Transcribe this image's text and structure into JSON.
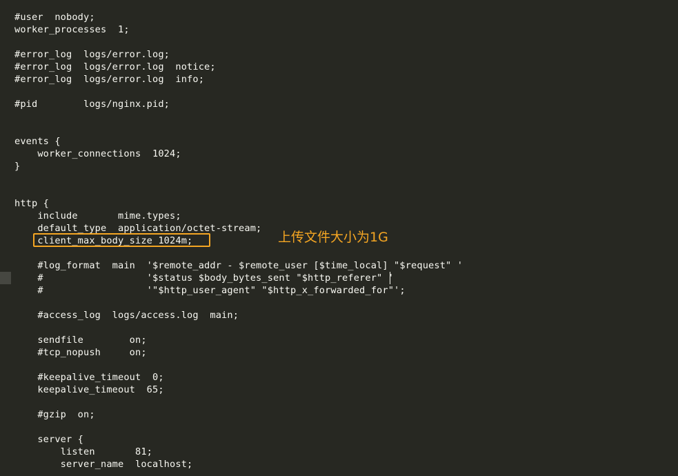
{
  "editor": {
    "lines": [
      "#user  nobody;",
      "worker_processes  1;",
      "",
      "#error_log  logs/error.log;",
      "#error_log  logs/error.log  notice;",
      "#error_log  logs/error.log  info;",
      "",
      "#pid        logs/nginx.pid;",
      "",
      "",
      "events {",
      "    worker_connections  1024;",
      "}",
      "",
      "",
      "http {",
      "    include       mime.types;",
      "    default_type  application/octet-stream;",
      "    client_max_body_size 1024m;",
      "",
      "    #log_format  main  '$remote_addr - $remote_user [$time_local] \"$request\" '",
      "    #                  '$status $body_bytes_sent \"$http_referer\" '",
      "    #                  '\"$http_user_agent\" \"$http_x_forwarded_for\"';",
      "",
      "    #access_log  logs/access.log  main;",
      "",
      "    sendfile        on;",
      "    #tcp_nopush     on;",
      "",
      "    #keepalive_timeout  0;",
      "    keepalive_timeout  65;",
      "",
      "    #gzip  on;",
      "",
      "    server {",
      "        listen       81;",
      "        server_name  localhost;"
    ]
  },
  "annotation": {
    "text": "上传文件大小为1G",
    "color": "#f5a623"
  },
  "theme": {
    "background": "#272822",
    "foreground": "#f8f8f2"
  }
}
